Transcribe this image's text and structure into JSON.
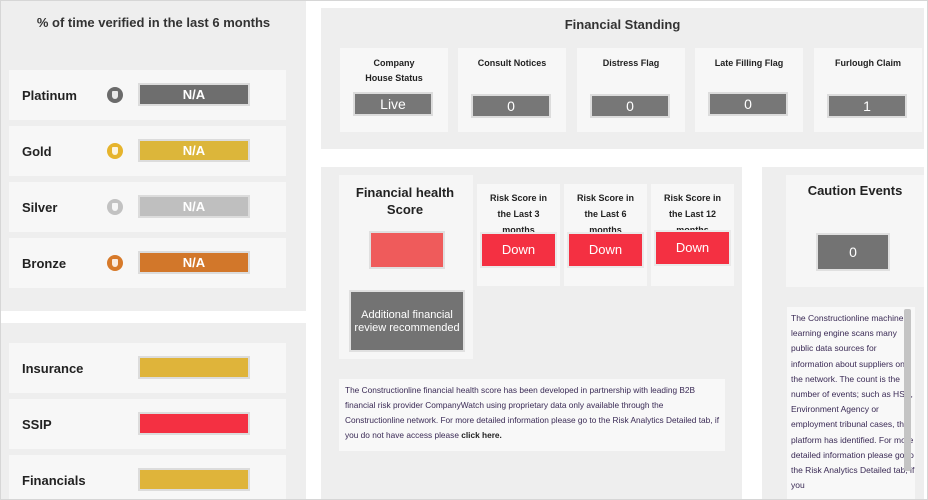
{
  "verified": {
    "title": "% of time verified in the last 6 months",
    "tiers": [
      {
        "label": "Platinum",
        "value": "N/A",
        "color": "#6e6e6e",
        "icon_color": "#6b6b6b",
        "icon": "platinum-badge-icon"
      },
      {
        "label": "Gold",
        "value": "N/A",
        "color": "#dcb63a",
        "icon_color": "#e6b42c",
        "icon": "gold-badge-icon"
      },
      {
        "label": "Silver",
        "value": "N/A",
        "color": "#bfbfbf",
        "icon_color": "#c2c2c2",
        "icon": "silver-badge-icon"
      },
      {
        "label": "Bronze",
        "value": "N/A",
        "color": "#d2772a",
        "icon_color": "#d77a2a",
        "icon": "bronze-badge-icon"
      }
    ]
  },
  "checks": [
    {
      "label": "Insurance",
      "color": "#dfb43a"
    },
    {
      "label": "SSIP",
      "color": "#f43042"
    },
    {
      "label": "Financials",
      "color": "#dfb43a"
    }
  ],
  "financial_standing": {
    "title": "Financial Standing",
    "items": [
      {
        "label": "Company House Status",
        "value": "Live"
      },
      {
        "label": "Consult Notices",
        "value": "0"
      },
      {
        "label": "Distress Flag",
        "value": "0"
      },
      {
        "label": "Late Filling Flag",
        "value": "0"
      },
      {
        "label": "Furlough Claim",
        "value": "1"
      }
    ]
  },
  "financial_health": {
    "title": "Financial health Score",
    "score_color": "#ef5b5b",
    "review_text": "Additional financial review recommended",
    "risk": [
      {
        "label": "Risk Score in the Last 3 months",
        "value": "Down"
      },
      {
        "label": "Risk Score in the Last 6 months",
        "value": "Down"
      },
      {
        "label": "Risk Score in the Last 12 months",
        "value": "Down"
      }
    ],
    "note": "The Constructionline financial health score has been developed in partnership with leading B2B financial risk provider CompanyWatch using proprietary data only available through the Constructionline network. For more detailed information please go to the Risk Analytics Detailed tab, if you do not have access please",
    "note_link": "click here."
  },
  "caution_events": {
    "title": "Caution Events",
    "count": "0",
    "description": "The Constructionline machine learning engine scans many public data sources for information about suppliers on the network. The count is the number of events; such as HSE, Environment Agency or employment tribunal cases, the platform has identified. For more detailed information please go to the Risk Analytics Detailed tab, if you"
  }
}
